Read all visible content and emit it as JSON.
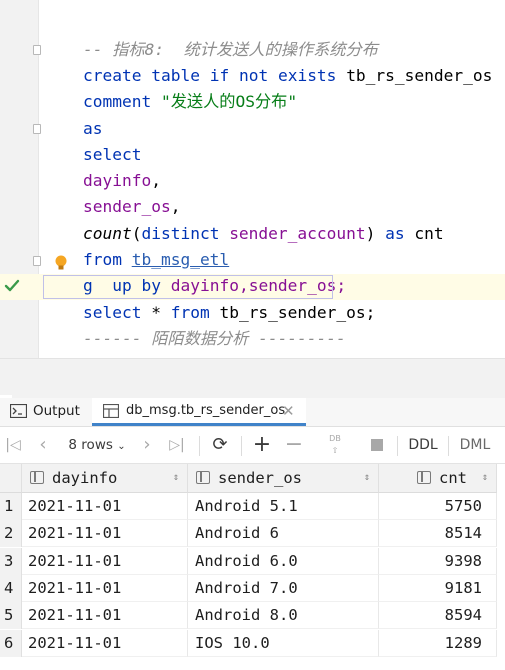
{
  "editor": {
    "comment1_dashes": "-- ",
    "comment1_label": "指标8:",
    "comment1_desc": "统计发送人的操作系统分布",
    "l_create": "create",
    "l_table": "table",
    "l_if": "if",
    "l_not": "not",
    "l_exists": "exists",
    "l_table_name": "tb_rs_sender_os",
    "l_comment": "comment",
    "l_comment_str": "\"发送人的OS分布\"",
    "l_as": "as",
    "l_select": "select",
    "l_dayinfo": "dayinfo",
    "l_sender_os": "sender_os",
    "l_comma": ",",
    "l_count": "count",
    "l_paren_open": "(",
    "l_distinct": "distinct",
    "l_sender_account": "sender_account",
    "l_paren_close": ")",
    "l_as2": "as",
    "l_cnt": "cnt",
    "l_from": "from",
    "l_source_table": "tb_msg_etl",
    "l_group": "g",
    "l_group_rest": "up",
    "l_by": "by",
    "l_group_cols": "dayinfo,sender_os;",
    "l_select2": "select",
    "l_star": "*",
    "l_from2": "from",
    "l_sel_table": "tb_rs_sender_os",
    "l_semi": ";",
    "comment2": "------ 陌陌数据分析 ---------"
  },
  "tabs": {
    "output_label": "Output",
    "result_label": "db_msg.tb_rs_sender_os"
  },
  "toolbar": {
    "rows_label": "8 rows",
    "ddl_label": "DDL",
    "dml_label": "DML"
  },
  "grid": {
    "columns": [
      "dayinfo",
      "sender_os",
      "cnt"
    ],
    "rows": [
      {
        "n": "1",
        "dayinfo": "2021-11-01",
        "sender_os": "Android 5.1",
        "cnt": "5750"
      },
      {
        "n": "2",
        "dayinfo": "2021-11-01",
        "sender_os": "Android 6",
        "cnt": "8514"
      },
      {
        "n": "3",
        "dayinfo": "2021-11-01",
        "sender_os": "Android 6.0",
        "cnt": "9398"
      },
      {
        "n": "4",
        "dayinfo": "2021-11-01",
        "sender_os": "Android 7.0",
        "cnt": "9181"
      },
      {
        "n": "5",
        "dayinfo": "2021-11-01",
        "sender_os": "Android 8.0",
        "cnt": "8594"
      },
      {
        "n": "6",
        "dayinfo": "2021-11-01",
        "sender_os": "IOS 10.0",
        "cnt": "1289"
      }
    ]
  }
}
